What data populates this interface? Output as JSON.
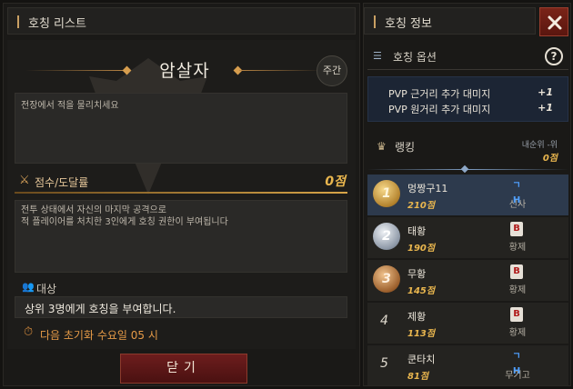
{
  "left_panel": {
    "header_title": "호칭 리스트",
    "title": "암살자",
    "period_badge": "주간",
    "description": "전장에서 적을 물리치세요",
    "score_label": "점수/도달률",
    "score_value": "0점",
    "condition_lines": [
      "전투 상태에서 자신의 마지막 공격으로",
      "적 플레이어를 처치한 3인에게 호칭 권한이 부여됩니다"
    ],
    "target_label": "대상",
    "target_text": "상위 3명에게 호칭을 부여합니다.",
    "reset_text": "다음 초기화 수요일 05 시",
    "close_button": "닫기"
  },
  "right_panel": {
    "header_title": "호칭 정보",
    "options_label": "호칭 옵션",
    "options": [
      {
        "label": "PVP 근거리 추가 대미지",
        "value": "+1"
      },
      {
        "label": "PVP 원거리 추가 대미지",
        "value": "+1"
      }
    ],
    "ranking_label": "랭킹",
    "my_rank_label": "내순위 -위",
    "my_rank_score": "0점",
    "rankings": [
      {
        "rank": "1",
        "name": "멍짱구11",
        "score": "210점",
        "server_badge": "ㄱH",
        "server": "신사"
      },
      {
        "rank": "2",
        "name": "태황",
        "score": "190점",
        "server_badge": "B",
        "server": "황제"
      },
      {
        "rank": "3",
        "name": "무황",
        "score": "145점",
        "server_badge": "B",
        "server": "황제"
      },
      {
        "rank": "4",
        "name": "제황",
        "score": "113점",
        "server_badge": "B",
        "server": "황제"
      },
      {
        "rank": "5",
        "name": "쿤타치",
        "score": "81점",
        "server_badge": "ㄱH",
        "server": "무기고"
      }
    ]
  },
  "colors": {
    "accent_gold": "#e9b64e",
    "accent_orange": "#e59a47",
    "button_red": "#6d1d1d",
    "highlight_row": "#2d3a4d"
  }
}
